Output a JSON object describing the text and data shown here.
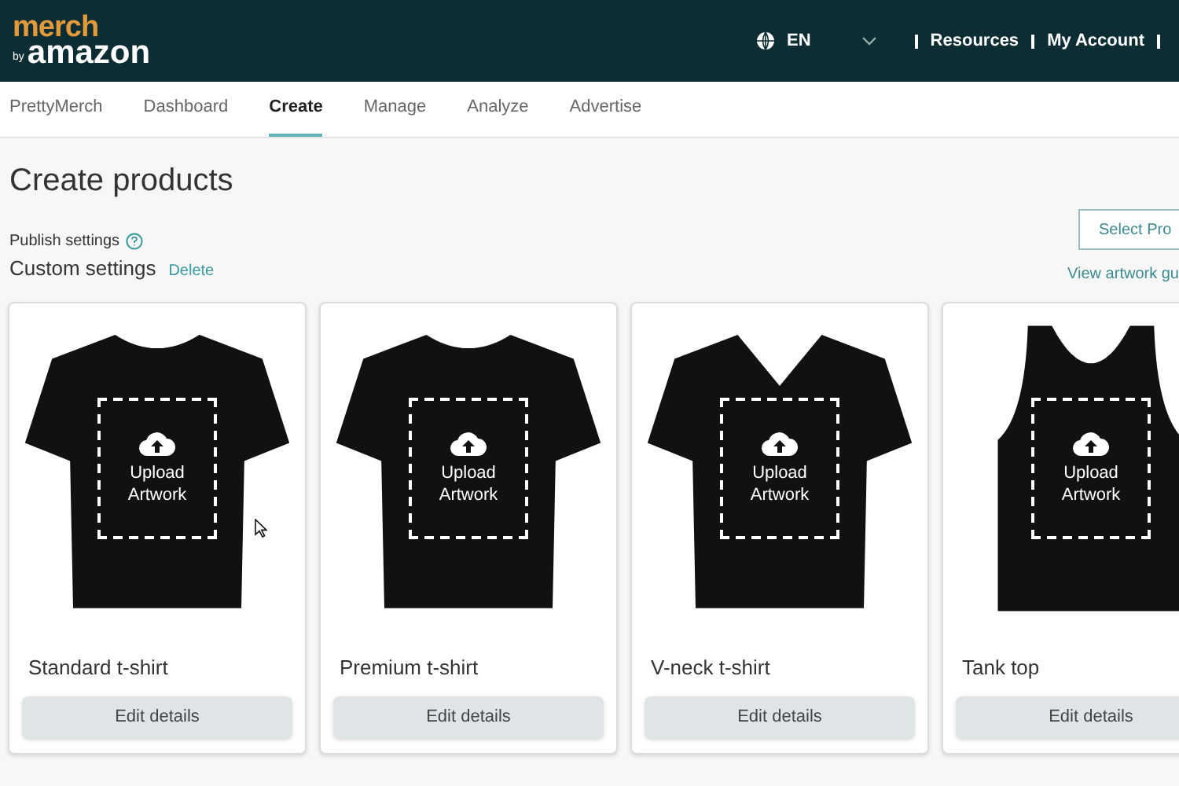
{
  "header": {
    "logo_top": "merch",
    "logo_by": "by",
    "logo_bottom": "amazon",
    "language": "EN",
    "links": [
      "Resources",
      "My Account"
    ]
  },
  "nav": [
    {
      "label": "PrettyMerch",
      "selected": false
    },
    {
      "label": "Dashboard",
      "selected": false
    },
    {
      "label": "Create",
      "selected": true
    },
    {
      "label": "Manage",
      "selected": false
    },
    {
      "label": "Analyze",
      "selected": false
    },
    {
      "label": "Advertise",
      "selected": false
    }
  ],
  "page_title": "Create products",
  "publish": {
    "label": "Publish settings",
    "value": "Custom settings",
    "action": "Delete"
  },
  "select_button": "Select Pro",
  "guide_link": "View artwork gu",
  "products": [
    {
      "kind": "tshirt",
      "name": "Standard t-shirt",
      "upload": "Upload Artwork",
      "button": "Edit details"
    },
    {
      "kind": "tshirt",
      "name": "Premium t-shirt",
      "upload": "Upload Artwork",
      "button": "Edit details"
    },
    {
      "kind": "vneck",
      "name": "V-neck t-shirt",
      "upload": "Upload Artwork",
      "button": "Edit details"
    },
    {
      "kind": "tank",
      "name": "Tank top",
      "upload": "Upload Artwork",
      "button": "Edit details"
    }
  ]
}
